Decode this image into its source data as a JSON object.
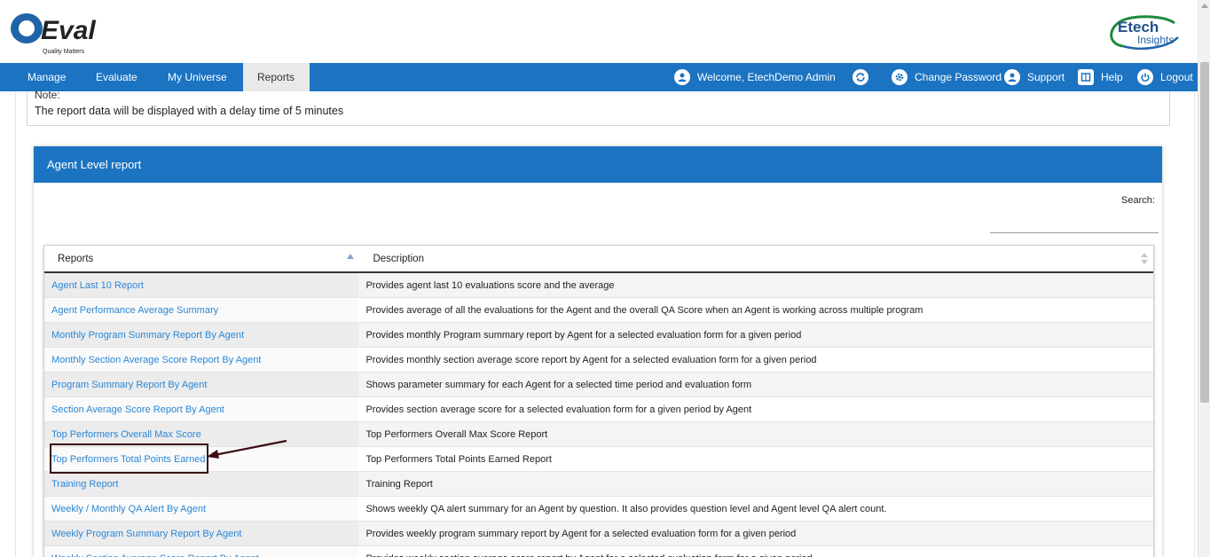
{
  "header": {
    "brand_name": "QEval",
    "brand_tagline": "Quality Matters",
    "partner_name_top": "Etech",
    "partner_name_bottom": "Insights"
  },
  "nav": {
    "items": [
      {
        "label": "Manage"
      },
      {
        "label": "Evaluate"
      },
      {
        "label": "My Universe"
      },
      {
        "label": "Reports"
      }
    ],
    "welcome": "Welcome, EtechDemo Admin",
    "change_password": "Change Password",
    "support": "Support",
    "help": "Help",
    "logout": "Logout"
  },
  "note": {
    "title": "Note:",
    "text": "The report data will be displayed with a delay time of 5 minutes"
  },
  "panel": {
    "title": "Agent Level report",
    "search_label": "Search:"
  },
  "table": {
    "headers": [
      "Reports",
      "Description"
    ],
    "rows": [
      {
        "report": "Agent Last 10 Report",
        "description": "Provides agent last 10 evaluations score and the average"
      },
      {
        "report": "Agent Performance Average Summary",
        "description": "Provides average of all the evaluations for the Agent and the overall QA Score when an Agent is working across multiple program"
      },
      {
        "report": "Monthly Program Summary Report By Agent",
        "description": "Provides monthly Program summary report by Agent for a selected evaluation form for a given period"
      },
      {
        "report": "Monthly Section Average Score Report By Agent",
        "description": "Provides monthly section average score report by Agent for a selected evaluation form for a given period"
      },
      {
        "report": "Program Summary Report By Agent",
        "description": "Shows parameter summary for each Agent for a selected time period and evaluation form"
      },
      {
        "report": "Section Average Score Report By Agent",
        "description": "Provides section average score for a selected evaluation form for a given period by Agent"
      },
      {
        "report": "Top Performers Overall Max Score",
        "description": "Top Performers Overall Max Score Report"
      },
      {
        "report": "Top Performers Total Points Earned",
        "description": "Top Performers Total Points Earned Report"
      },
      {
        "report": "Training Report",
        "description": "Training Report"
      },
      {
        "report": "Weekly / Monthly QA Alert By Agent",
        "description": "Shows weekly QA alert summary for an Agent by question. It also provides question level and Agent level QA alert count."
      },
      {
        "report": "Weekly Program Summary Report By Agent",
        "description": "Provides weekly program summary report by Agent for a selected evaluation form for a given period"
      },
      {
        "report": "Weekly Section Average Score Report By Agent",
        "description": "Provides weekly section average score report by Agent for a selected evaluation form for a given period"
      }
    ]
  },
  "colors": {
    "primary": "#1b73c2",
    "link": "#2a87d6",
    "annotation": "#3b0d12"
  }
}
